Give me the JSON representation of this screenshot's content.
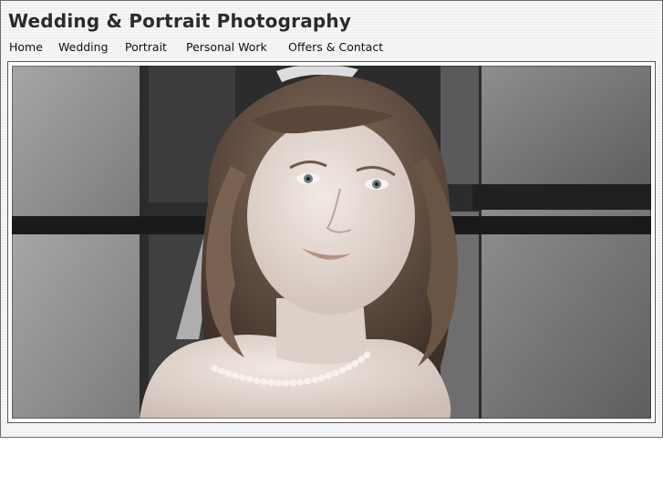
{
  "site": {
    "title": "Wedding & Portrait Photography"
  },
  "nav": {
    "items": [
      {
        "label": "Home"
      },
      {
        "label": "Wedding"
      },
      {
        "label": "Portrait"
      },
      {
        "label": "Personal Work"
      },
      {
        "label": "Offers & Contact"
      }
    ]
  },
  "hero": {
    "icon": "bridal-portrait-photo",
    "palette": {
      "stone_light": "#9a9a9a",
      "stone_dark": "#4a4a4a",
      "mortar": "#1e1e1e",
      "hair": "#6b5648",
      "skin": "#e9ddd6",
      "pearl": "#f7f2ee"
    }
  }
}
